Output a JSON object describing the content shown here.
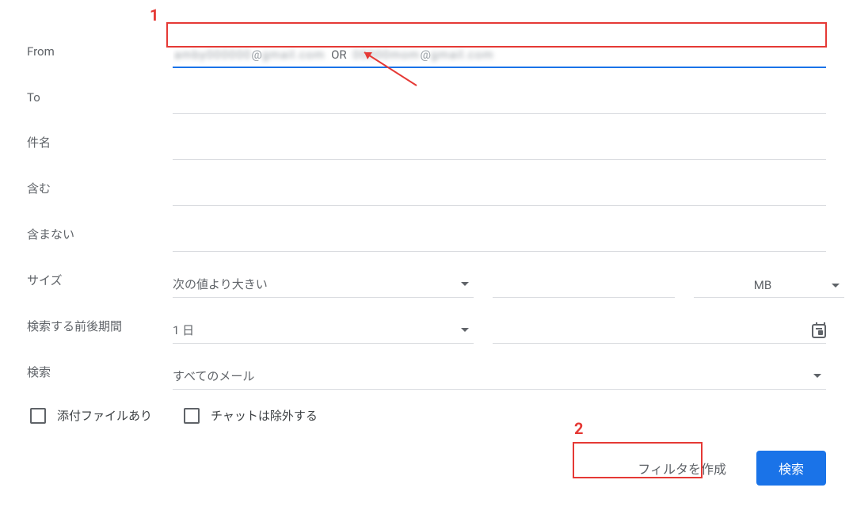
{
  "fields": {
    "from": {
      "label": "From",
      "value_display": "████████@████████ OR ████████@████████",
      "or_text": "OR"
    },
    "to": {
      "label": "To",
      "value": ""
    },
    "subject": {
      "label": "件名",
      "value": ""
    },
    "has_words": {
      "label": "含む",
      "value": ""
    },
    "not_has_words": {
      "label": "含まない",
      "value": ""
    },
    "size": {
      "label": "サイズ",
      "selected": "次の値より大きい",
      "amount": "",
      "unit": "MB"
    },
    "date": {
      "label": "検索する前後期間",
      "selected": "1 日",
      "value": ""
    },
    "search_scope": {
      "label": "検索",
      "selected": "すべてのメール"
    }
  },
  "checkboxes": {
    "has_attachment": "添付ファイルあり",
    "exclude_chats": "チャットは除外する"
  },
  "buttons": {
    "create_filter": "フィルタを作成",
    "search": "検索"
  },
  "annotations": {
    "one": "1",
    "two": "2"
  }
}
